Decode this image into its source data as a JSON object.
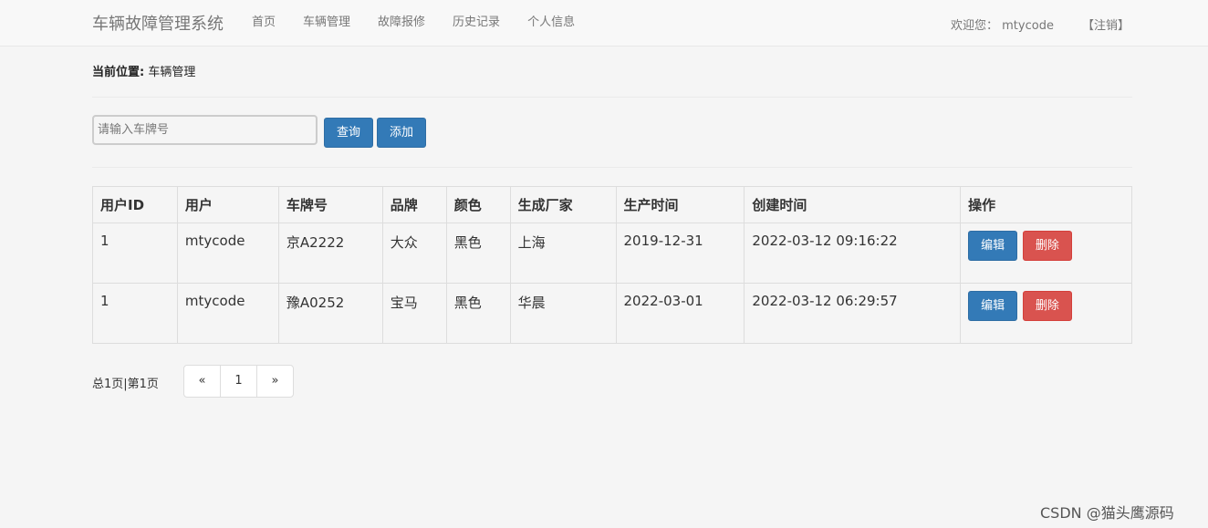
{
  "navbar": {
    "brand": "车辆故障管理系统",
    "items": [
      {
        "label": "首页"
      },
      {
        "label": "车辆管理"
      },
      {
        "label": "故障报修"
      },
      {
        "label": "历史记录"
      },
      {
        "label": "个人信息"
      }
    ],
    "welcome": "欢迎您： mtycode",
    "logout": "【注销】"
  },
  "breadcrumb": {
    "label": "当前位置:",
    "current": "车辆管理"
  },
  "search": {
    "placeholder": "请输入车牌号",
    "query_label": "查询",
    "add_label": "添加"
  },
  "table": {
    "headers": [
      "用户ID",
      "用户",
      "车牌号",
      "品牌",
      "颜色",
      "生成厂家",
      "生产时间",
      "创建时间",
      "操作"
    ],
    "rows": [
      {
        "user_id": "1",
        "user": "mtycode",
        "plate": "京A2222",
        "brand": "大众",
        "color": "黑色",
        "maker": "上海",
        "produced": "2019-12-31",
        "created": "2022-03-12 09:16:22"
      },
      {
        "user_id": "1",
        "user": "mtycode",
        "plate": "豫A0252",
        "brand": "宝马",
        "color": "黑色",
        "maker": "华晨",
        "produced": "2022-03-01",
        "created": "2022-03-12 06:29:57"
      }
    ],
    "edit_label": "编辑",
    "delete_label": "删除"
  },
  "pagination": {
    "info": "总1页|第1页",
    "prev": "«",
    "current": "1",
    "next": "»"
  },
  "watermark": "CSDN @猫头鹰源码",
  "colors": {
    "primary": "#337ab7",
    "danger": "#d9534f"
  }
}
